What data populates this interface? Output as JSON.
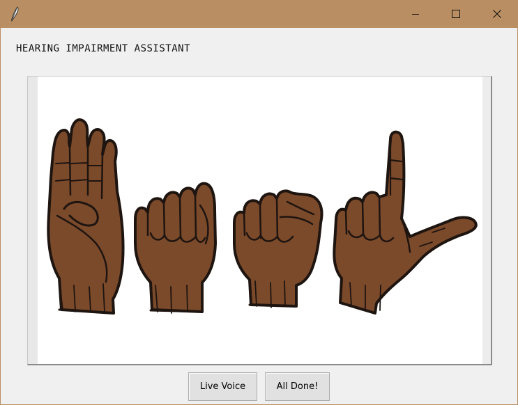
{
  "window": {
    "title": "",
    "icon": "feather-icon",
    "controls": {
      "minimize_icon": "minimize-icon",
      "maximize_icon": "maximize-icon",
      "close_icon": "close-icon"
    },
    "titlebar_color": "#b98e62"
  },
  "main": {
    "heading": "HEARING IMPAIRMENT ASSISTANT",
    "image": {
      "description_icon": "sign-language-hands-image",
      "skin_color": "#7b4a2a",
      "outline_color": "#1e1410"
    }
  },
  "buttons": {
    "live_voice_label": "Live Voice",
    "all_done_label": "All Done!"
  }
}
